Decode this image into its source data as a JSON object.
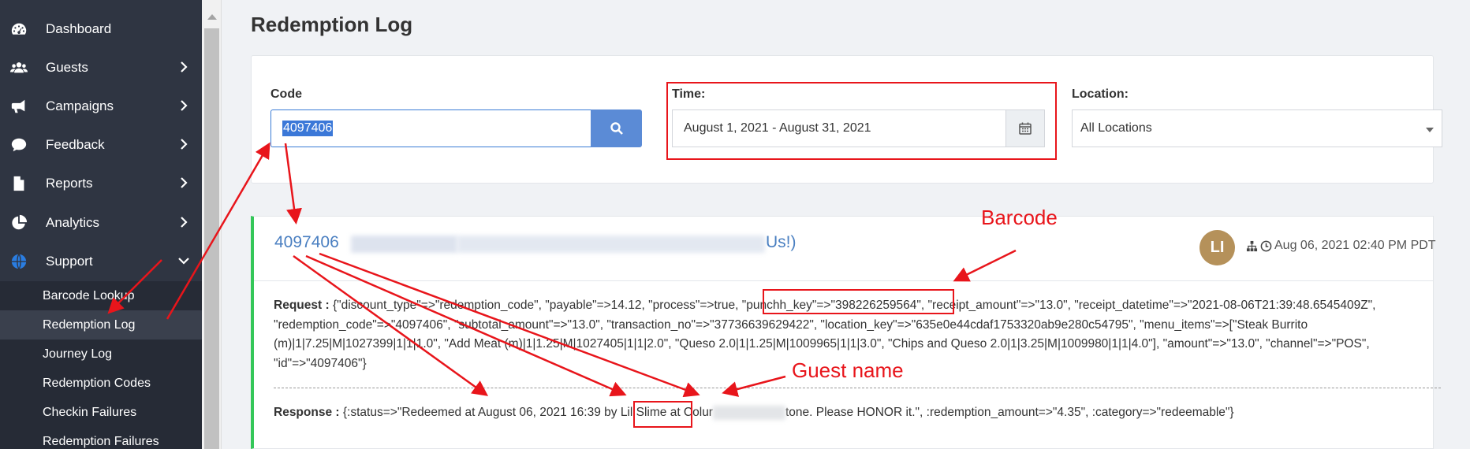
{
  "sidebar": {
    "items": [
      {
        "label": "Dashboard",
        "icon": "dashboard-icon",
        "has_chevron": false
      },
      {
        "label": "Guests",
        "icon": "users-icon",
        "has_chevron": true
      },
      {
        "label": "Campaigns",
        "icon": "bullhorn-icon",
        "has_chevron": true
      },
      {
        "label": "Feedback",
        "icon": "comment-icon",
        "has_chevron": true
      },
      {
        "label": "Reports",
        "icon": "file-icon",
        "has_chevron": true
      },
      {
        "label": "Analytics",
        "icon": "pie-chart-icon",
        "has_chevron": true
      },
      {
        "label": "Support",
        "icon": "globe-icon",
        "has_chevron": true
      }
    ],
    "sub_items": [
      {
        "label": "Barcode Lookup",
        "active": false
      },
      {
        "label": "Redemption Log",
        "active": true
      },
      {
        "label": "Journey Log",
        "active": false
      },
      {
        "label": "Redemption Codes",
        "active": false
      },
      {
        "label": "Checkin Failures",
        "active": false
      },
      {
        "label": "Redemption Failures",
        "active": false
      }
    ]
  },
  "page": {
    "title": "Redemption Log"
  },
  "filters": {
    "code_label": "Code",
    "code_value": "4097406",
    "time_label": "Time:",
    "time_value": "August 1, 2021 - August 31, 2021",
    "location_label": "Location:",
    "location_value": "All Locations"
  },
  "result": {
    "code": "4097406",
    "title_tail": "Us!)",
    "avatar_initials": "LI",
    "timestamp": "Aug 06, 2021 02:40 PM PDT",
    "request_label": "Request :",
    "request_text": "{\"discount_type\"=>\"redemption_code\", \"payable\"=>14.12, \"process\"=>true, \"punchh_key\"=>\"398226259564\", \"receipt_amount\"=>\"13.0\", \"receipt_datetime\"=>\"2021-08-06T21:39:48.6545409Z\", \"redemption_code\"=>\"4097406\", \"subtotal_amount\"=>\"13.0\", \"transaction_no\"=>\"37736639629422\", \"location_key\"=>\"635e0e44cdaf1753320ab9e280c54795\", \"menu_items\"=>[\"Steak Burrito (m)|1|7.25|M|1027399|1|1|1.0\", \"Add Meat (m)|1|1.25|M|1027405|1|1|2.0\", \"Queso 2.0|1|1.25|M|1009965|1|1|3.0\", \"Chips and Queso 2.0|1|3.25|M|1009980|1|1|4.0\"], \"amount\"=>\"13.0\", \"channel\"=>\"POS\", \"id\"=>\"4097406\"}",
    "response_label": "Response :",
    "response_pre": "{:status=>\"Redeemed at August 06, 2021 16:39 by ",
    "response_name": "Lil Slime",
    "response_mid": " at Colur",
    "response_post": "tone. Please HONOR it.\", :redemption_amount=>\"4.35\", :category=>\"redeemable\"}"
  },
  "annotations": {
    "barcode": "Barcode",
    "guest_name": "Guest name",
    "color": "#e8151b"
  }
}
